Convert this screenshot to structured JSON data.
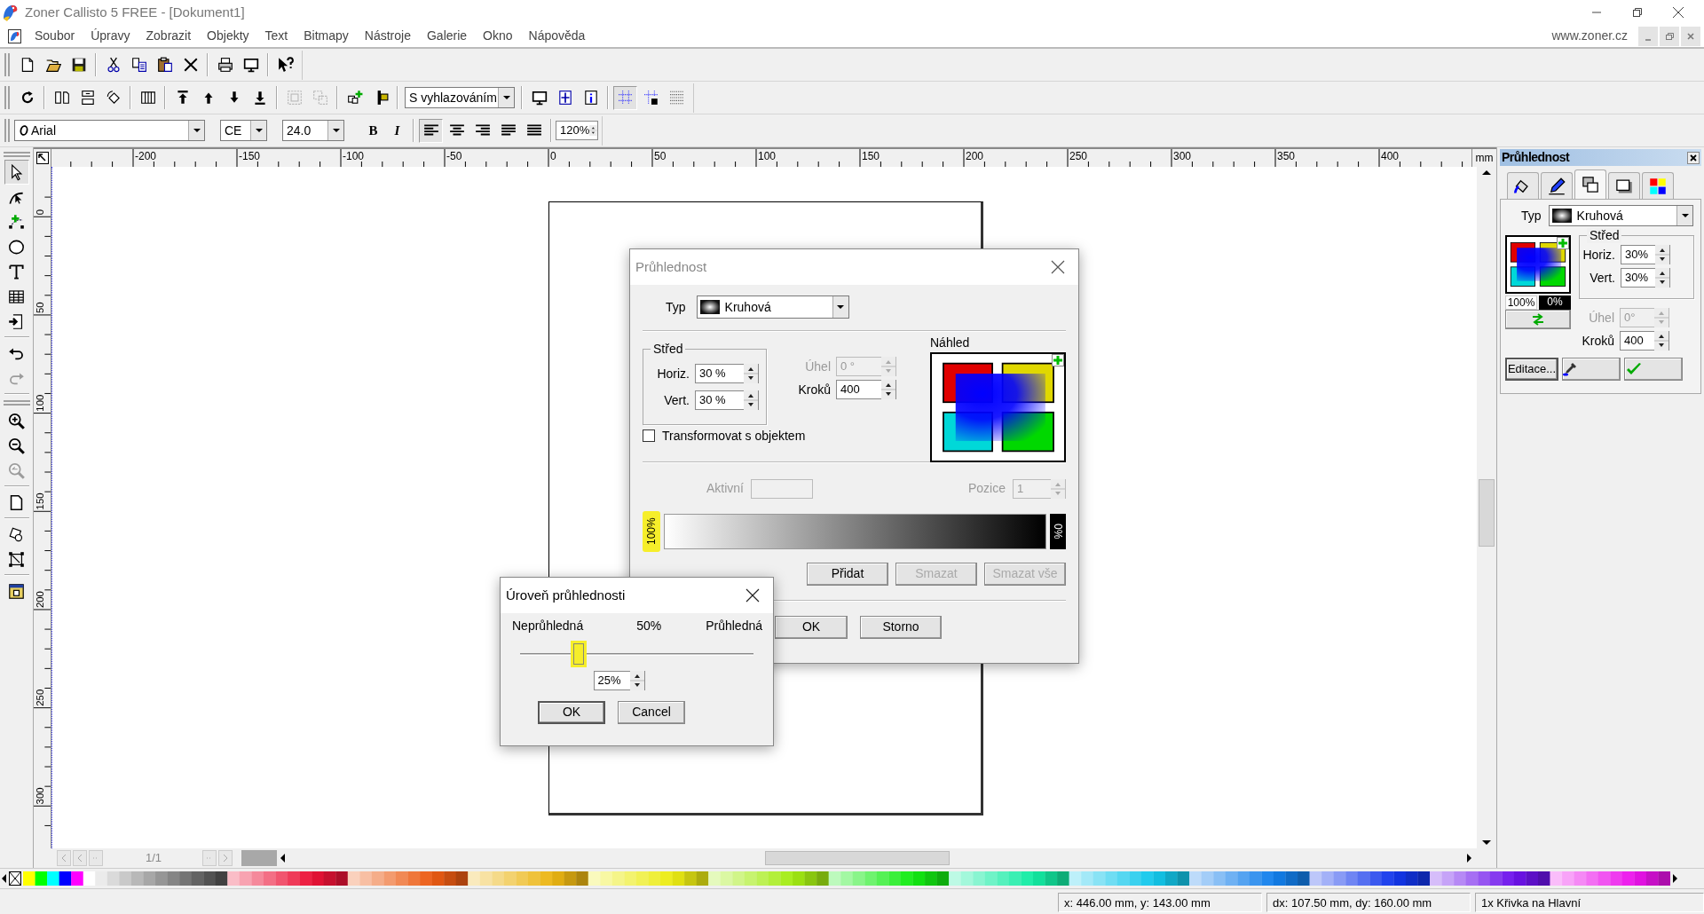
{
  "window": {
    "title": "Zoner Callisto 5 FREE - [Dokument1]"
  },
  "menu": {
    "items": [
      "Soubor",
      "Úpravy",
      "Zobrazit",
      "Objekty",
      "Text",
      "Bitmapy",
      "Nástroje",
      "Galerie",
      "Okno",
      "Nápověda"
    ],
    "link": "www.zoner.cz"
  },
  "toolbars": [
    {
      "groups": [
        [
          {
            "kind": "new-document",
            "disabled": false,
            "pressed": false
          },
          {
            "kind": "folder",
            "disabled": false,
            "pressed": false
          },
          {
            "kind": "floppy-disk",
            "disabled": false,
            "pressed": false
          }
        ],
        [
          {
            "kind": "scissors",
            "disabled": false,
            "pressed": false
          },
          {
            "kind": "copy",
            "disabled": false,
            "pressed": false
          },
          {
            "kind": "clipboard",
            "disabled": false,
            "pressed": false
          },
          {
            "kind": "cross",
            "disabled": false,
            "pressed": false
          }
        ],
        [
          {
            "kind": "printer",
            "disabled": false,
            "pressed": false
          },
          {
            "kind": "monitor",
            "disabled": false,
            "pressed": false
          }
        ],
        [
          {
            "kind": "help-pointer",
            "disabled": false,
            "pressed": false
          }
        ]
      ]
    },
    {
      "groups": [
        [
          {
            "kind": "rotate",
            "disabled": false,
            "pressed": false
          }
        ],
        [
          {
            "kind": "flip-horizontal",
            "disabled": false,
            "pressed": false
          },
          {
            "kind": "flip-vertical",
            "disabled": false,
            "pressed": false
          },
          {
            "kind": "rotate-diamond",
            "disabled": false,
            "pressed": false
          }
        ],
        [
          {
            "kind": "columns",
            "disabled": false,
            "pressed": false
          }
        ],
        [
          {
            "kind": "bring-to-front",
            "disabled": false,
            "pressed": false
          },
          {
            "kind": "arrow-up",
            "disabled": false,
            "pressed": false
          },
          {
            "kind": "arrow-down",
            "disabled": false,
            "pressed": false
          },
          {
            "kind": "send-to-back",
            "disabled": false,
            "pressed": false
          }
        ],
        [
          {
            "kind": "group",
            "disabled": true,
            "pressed": false
          },
          {
            "kind": "ungroup",
            "disabled": true,
            "pressed": false
          }
        ],
        [
          {
            "kind": "add-object",
            "disabled": false,
            "pressed": false
          },
          {
            "kind": "align-bar",
            "disabled": false,
            "pressed": false
          }
        ],
        [
          {
            "kind": "dropdown",
            "value": "S vyhlazováním"
          }
        ],
        [
          {
            "kind": "monitor",
            "disabled": false,
            "pressed": false
          },
          {
            "kind": "page-crosshair",
            "disabled": false,
            "pressed": false
          },
          {
            "kind": "info",
            "disabled": false,
            "pressed": false
          }
        ],
        [
          {
            "kind": "grid",
            "disabled": false,
            "pressed": true
          },
          {
            "kind": "grid-lock",
            "disabled": false,
            "pressed": false
          },
          {
            "kind": "dot-grid",
            "disabled": false,
            "pressed": false
          }
        ]
      ]
    },
    {
      "groups": [
        [
          {
            "kind": "font",
            "value": "Arial"
          },
          {
            "kind": "dropdown",
            "value": "CE"
          },
          {
            "kind": "dropdown",
            "value": "24.0"
          },
          {
            "kind": "bold",
            "label": "B"
          },
          {
            "kind": "italic",
            "label": "I"
          }
        ],
        [
          {
            "kind": "align-left",
            "disabled": false,
            "pressed": true
          },
          {
            "kind": "align-center",
            "disabled": false,
            "pressed": false
          },
          {
            "kind": "align-right",
            "disabled": false,
            "pressed": false
          },
          {
            "kind": "justify",
            "disabled": false,
            "pressed": false
          },
          {
            "kind": "justify-all",
            "disabled": false,
            "pressed": false
          }
        ],
        [
          {
            "kind": "spin",
            "value": "120%"
          }
        ]
      ]
    }
  ],
  "tools": [
    [
      {
        "kind": "pointer",
        "selected": true,
        "disabled": false
      },
      {
        "kind": "node-edit",
        "selected": false,
        "disabled": false
      },
      {
        "kind": "node-add",
        "selected": false,
        "disabled": false
      },
      {
        "kind": "ellipse",
        "selected": false,
        "disabled": false
      },
      {
        "kind": "text-tool",
        "selected": false,
        "disabled": false
      },
      {
        "kind": "table",
        "selected": false,
        "disabled": false
      },
      {
        "kind": "import",
        "selected": false,
        "disabled": false
      }
    ],
    [
      {
        "kind": "undo",
        "selected": false,
        "disabled": false
      },
      {
        "kind": "redo",
        "selected": false,
        "disabled": true
      }
    ],
    [
      {
        "kind": "zoom-in",
        "selected": false,
        "disabled": false
      },
      {
        "kind": "zoom-out",
        "selected": false,
        "disabled": false
      },
      {
        "kind": "zoom-back",
        "selected": false,
        "disabled": true
      }
    ],
    [
      {
        "kind": "page",
        "selected": false,
        "disabled": false
      }
    ],
    [
      {
        "kind": "shape",
        "selected": false,
        "disabled": false
      },
      {
        "kind": "transform",
        "selected": false,
        "disabled": false
      }
    ],
    [
      {
        "kind": "frame",
        "selected": false,
        "disabled": false
      }
    ]
  ],
  "rulers": {
    "horizontal": [
      "-200",
      "-150",
      "-100",
      "-50",
      "0",
      "50",
      "100",
      "150",
      "200",
      "250",
      "300",
      "350",
      "400"
    ],
    "unit": "mm",
    "vertical": [
      "0",
      "50",
      "100",
      "150",
      "200",
      "250",
      "300"
    ]
  },
  "side_panel": {
    "title": "Průhlednost",
    "tabs": [
      {
        "kind": "paint-bucket",
        "selected": false
      },
      {
        "kind": "pen",
        "selected": false
      },
      {
        "kind": "overlap-squares",
        "selected": true
      },
      {
        "kind": "shadow-square",
        "selected": false
      },
      {
        "kind": "color-squares",
        "selected": false
      }
    ],
    "type_label": "Typ",
    "type_value": "Kruhová",
    "start_value": "100%",
    "end_value": "0%",
    "center_label": "Střed",
    "fields": [
      {
        "label": "Horiz.",
        "value": "30%",
        "disabled": false
      },
      {
        "label": "Vert.",
        "value": "30%",
        "disabled": false
      },
      {
        "label": "Úhel",
        "value": "0°",
        "disabled": true
      },
      {
        "label": "Kroků",
        "value": "400",
        "disabled": false
      }
    ],
    "edit_button": "Editace..."
  },
  "dialog": {
    "title": "Průhlednost",
    "type_label": "Typ",
    "type_value": "Kruhová",
    "center_label": "Střed",
    "fields": [
      {
        "label": "Horiz.",
        "value": "30 %",
        "disabled": false
      },
      {
        "label": "Vert.",
        "value": "30 %",
        "disabled": false
      },
      {
        "label": "Úhel",
        "value": "0 °",
        "disabled": true
      },
      {
        "label": "Kroků",
        "value": "400",
        "disabled": false
      }
    ],
    "preview_label": "Náhled",
    "transform": {
      "label": "Transformovat s objektem",
      "checked": false
    },
    "active": {
      "label": "Aktivní",
      "disabled": true
    },
    "position": {
      "label": "Pozice",
      "value": "1",
      "disabled": true
    },
    "gradient_start": "100%",
    "gradient_end": "0%",
    "buttons": [
      {
        "label": "Přidat",
        "disabled": false
      },
      {
        "label": "Smazat",
        "disabled": true
      },
      {
        "label": "Smazat vše",
        "disabled": true
      }
    ],
    "ok": "OK",
    "cancel": "Storno"
  },
  "level_dialog": {
    "title": "Úroveň průhlednosti",
    "left_label": "Neprůhledná",
    "mid_label": "50%",
    "right_label": "Průhledná",
    "level": 0.25,
    "value": "25%",
    "ok": "OK",
    "cancel": "Cancel"
  },
  "page_nav": {
    "page": "1/1"
  },
  "status_bar": [
    "x: 446.00 mm, y: 143.00 mm",
    "dx: 107.50 mm, dy: 160.00 mm",
    "1x Křivka na Hlavní"
  ]
}
